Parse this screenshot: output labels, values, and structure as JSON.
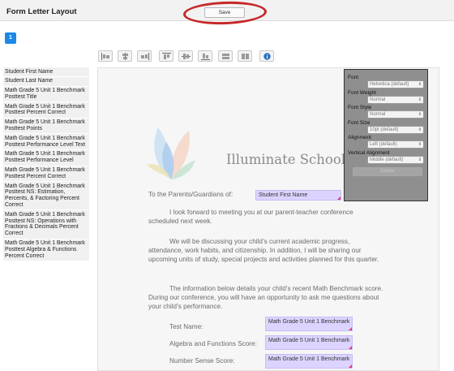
{
  "header": {
    "title": "Form Letter Layout",
    "save_label": "Save"
  },
  "pages": {
    "current": "1"
  },
  "toolbar": {
    "icons": [
      "align-left-icon",
      "align-center-icon",
      "align-right-icon",
      "align-top-icon",
      "align-middle-icon",
      "align-bottom-icon",
      "same-width-icon",
      "same-height-icon",
      "info-icon"
    ]
  },
  "fields": [
    "Student First Name",
    "Student Last Name",
    "Math Grade 5 Unit 1 Benchmark Posttest Title",
    "Math Grade 5 Unit 1 Benchmark Posttest Percent Correct",
    "Math Grade 5 Unit 1 Benchmark Posttest Points",
    "Math Grade 5 Unit 1 Benchmark Posttest Performance Level Text",
    "Math Grade 5 Unit 1 Benchmark Posttest Performance Level",
    "Math Grade 5 Unit 1 Benchmark Posttest Percent Correct",
    "Math Grade 5 Unit 1 Benchmark Posttest NS: Estimation, Percents, & Factoring Percent Correct",
    "Math Grade 5 Unit 1 Benchmark Posttest NS: Operations with Fractions & Decimals Percent Correct",
    "Math Grade 5 Unit 1 Benchmark Posttest Algebra & Functions Percent Correct"
  ],
  "document": {
    "school_name": "Illuminate School",
    "greeting": "To the Parents/Guardians of:",
    "greeting_field": "Student First Name",
    "p1": "I look forward to meeting you at our parent-teacher conference scheduled next week.",
    "p2": "We will be discussing your child’s current academic progress, attendance, work habits, and citizenship. In addition, I will be sharing our upcoming units of study, special projects and activities planned for this quarter.",
    "p3": "The information below details your child’s recent Math Benchmark score. During our conference, you will have an opportunity to ask me questions about your child’s performance.",
    "test_name_label": "Test Name:",
    "test_name_field": "Math Grade 5 Unit 1 Benchmark",
    "algebra_label": "Algebra and Functions Score:",
    "algebra_field": "Math Grade 5 Unit 1 Benchmark",
    "number_sense_label": "Number Sense Score:",
    "number_sense_field": "Math Grade 5 Unit 1 Benchmark"
  },
  "properties": {
    "font_label": "Font",
    "font_value": "Helvetica (default)",
    "weight_label": "Font Weight",
    "weight_value": "Normal",
    "style_label": "Font Style",
    "style_value": "Normal",
    "size_label": "Font Size",
    "size_value": "10pt (default)",
    "align_label": "Alignment",
    "align_value": "Left (default)",
    "valign_label": "Vertical Alignment",
    "valign_value": "Middle (default)",
    "delete_label": "Delete"
  },
  "colors": {
    "accent": "#1b88e8",
    "merge_field": "#dcd4ff",
    "highlight_ring": "#c62828"
  }
}
